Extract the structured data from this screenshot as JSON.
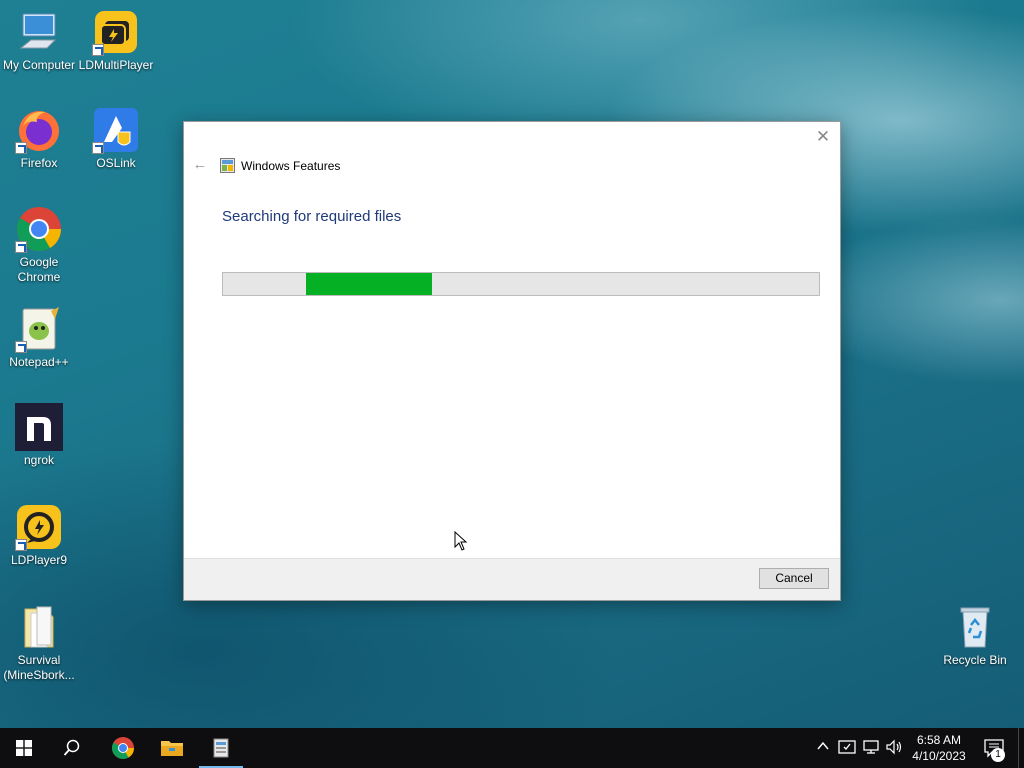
{
  "desktop": {
    "icons": [
      {
        "label": "My Computer",
        "icon": "computer-icon"
      },
      {
        "label": "LDMultiPlayer",
        "icon": "ldmultiplayer-icon"
      },
      {
        "label": "Firefox",
        "icon": "firefox-icon"
      },
      {
        "label": "OSLink",
        "icon": "oslink-icon"
      },
      {
        "label": "Google Chrome",
        "icon": "chrome-icon"
      },
      {
        "label": "Notepad++",
        "icon": "notepadpp-icon"
      },
      {
        "label": "ngrok",
        "icon": "ngrok-icon"
      },
      {
        "label": "LDPlayer9",
        "icon": "ldplayer-icon"
      },
      {
        "label": "Survival (MineSbork...",
        "icon": "folder-icon"
      },
      {
        "label": "Recycle Bin",
        "icon": "recycle-bin-icon"
      }
    ]
  },
  "dialog": {
    "title": "Windows Features",
    "heading": "Searching for required files",
    "cancel_label": "Cancel",
    "close_glyph": "✕",
    "back_glyph": "←",
    "progress": {
      "mode": "marquee",
      "chunk_start": 0.139,
      "chunk_end": 0.351,
      "color": "#06b025"
    }
  },
  "taskbar": {
    "items": [
      "start-icon",
      "search-icon",
      "chrome-icon",
      "file-explorer-icon",
      "windows-features-icon"
    ],
    "tray": [
      "chevron-up-icon",
      "security-icon",
      "network-icon",
      "volume-icon"
    ],
    "time": "6:58 AM",
    "date": "4/10/2023",
    "notification_count": "1"
  },
  "colors": {
    "accent": "#76b9ed",
    "heading": "#1e3a78",
    "taskbar": "#0e0e10"
  }
}
